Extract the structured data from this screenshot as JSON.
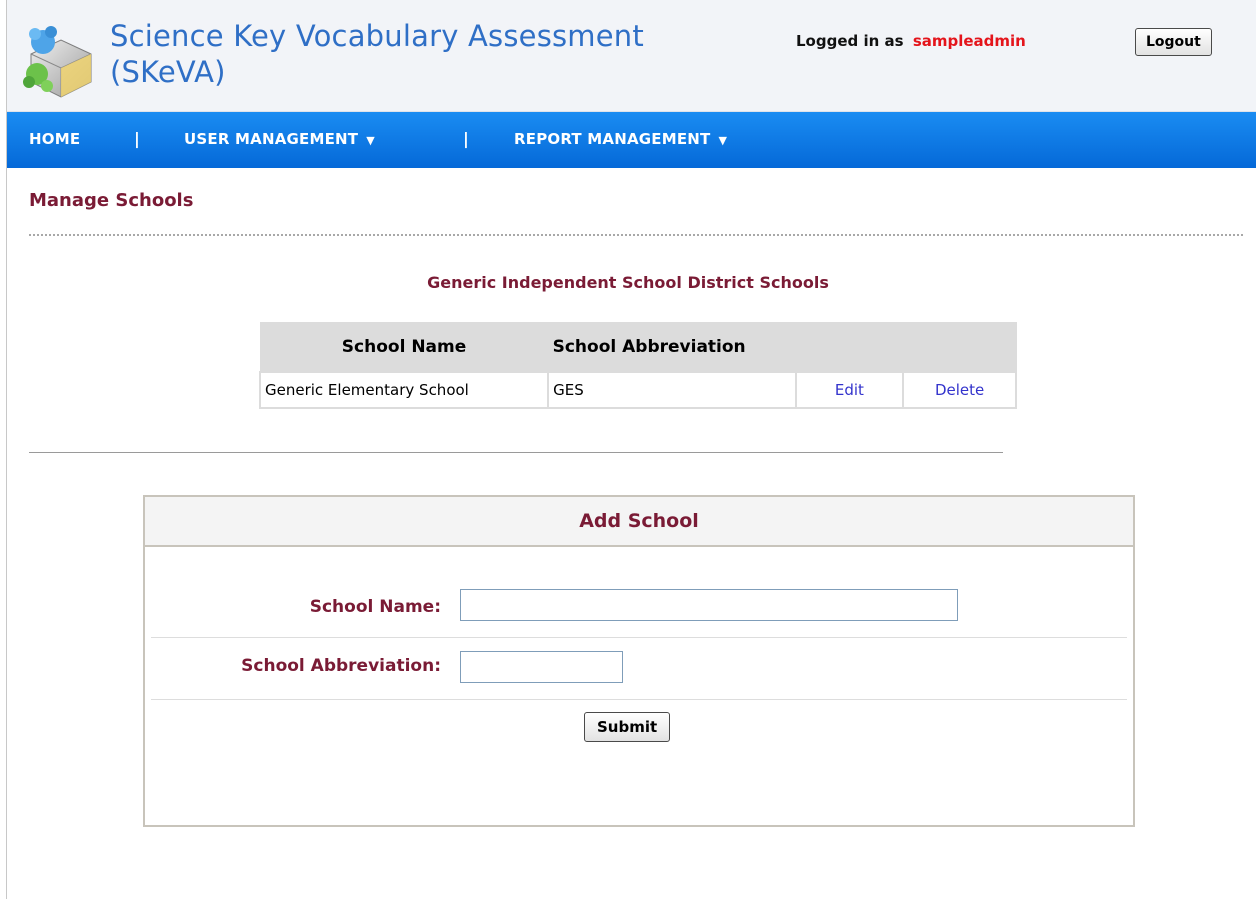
{
  "header": {
    "title": "Science Key Vocabulary Assessment (SKeVA)",
    "logged_in_label": "Logged in as",
    "username": "sampleadmin",
    "logout_label": "Logout",
    "logo_icon": "puzzle-pieces-icon"
  },
  "nav": {
    "items": [
      {
        "label": "HOME",
        "has_dropdown": false
      },
      {
        "label": "USER MANAGEMENT",
        "has_dropdown": true
      },
      {
        "label": "REPORT MANAGEMENT",
        "has_dropdown": true
      }
    ],
    "separator": "|"
  },
  "page": {
    "title": "Manage Schools",
    "district_title": "Generic Independent School District Schools"
  },
  "schools_table": {
    "columns": [
      "School Name",
      "School Abbreviation",
      "",
      ""
    ],
    "rows": [
      {
        "name": "Generic Elementary School",
        "abbreviation": "GES",
        "edit_label": "Edit",
        "delete_label": "Delete"
      }
    ]
  },
  "add_school": {
    "heading": "Add School",
    "name_label": "School Name:",
    "name_value": "",
    "abbreviation_label": "School Abbreviation:",
    "abbreviation_value": "",
    "submit_label": "Submit"
  },
  "colors": {
    "nav_bg": "#0a73e0",
    "title_blue": "#2f6fc6",
    "label_maroon": "#7a1b35",
    "username_red": "#e4141b",
    "link_blue": "#3333cc"
  }
}
